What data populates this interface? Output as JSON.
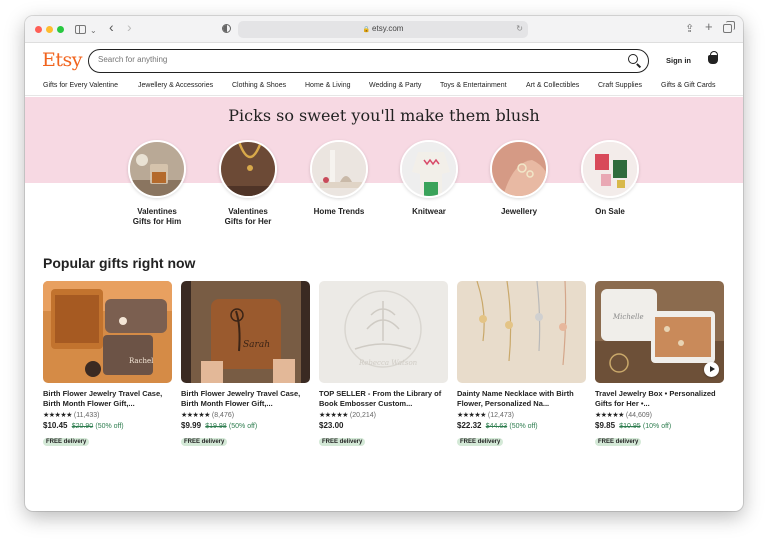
{
  "browser": {
    "url": "etsy.com",
    "icons": [
      "sidebar-icon",
      "chevron-down-icon",
      "back-icon",
      "forward-icon",
      "privacy-icon",
      "lock-icon",
      "reload-icon",
      "share-icon",
      "new-tab-icon",
      "tabs-overview-icon"
    ]
  },
  "header": {
    "logo": "Etsy",
    "search_placeholder": "Search for anything",
    "signin": "Sign in",
    "brand_color": "#f1641e"
  },
  "categories_nav": [
    "Gifts for Every Valentine",
    "Jewellery & Accessories",
    "Clothing & Shoes",
    "Home & Living",
    "Wedding & Party",
    "Toys & Entertainment",
    "Art & Collectibles",
    "Craft Supplies",
    "Gifts & Gift Cards"
  ],
  "banner": {
    "title": "Picks so sweet you'll make them blush",
    "background": "#f7d9e3",
    "categories": [
      {
        "label_line1": "Valentines",
        "label_line2": "Gifts for Him"
      },
      {
        "label_line1": "Valentines",
        "label_line2": "Gifts for Her"
      },
      {
        "label_line1": "Home Trends",
        "label_line2": ""
      },
      {
        "label_line1": "Knitwear",
        "label_line2": ""
      },
      {
        "label_line1": "Jewellery",
        "label_line2": ""
      },
      {
        "label_line1": "On Sale",
        "label_line2": ""
      }
    ]
  },
  "popular": {
    "heading": "Popular gifts right now",
    "products": [
      {
        "title": "Birth Flower Jewelry Travel Case, Birth Month Flower Gift,...",
        "stars": "★★★★★",
        "reviews": "(11,433)",
        "price": "$10.45",
        "original": "$20.90",
        "discount": "(50% off)",
        "badge": "FREE delivery"
      },
      {
        "title": "Birth Flower Jewelry Travel Case, Birth Month Flower Gift,...",
        "stars": "★★★★★",
        "reviews": "(8,476)",
        "price": "$9.99",
        "original": "$19.98",
        "discount": "(50% off)",
        "badge": "FREE delivery"
      },
      {
        "title": "TOP SELLER - From the Library of Book Embosser Custom...",
        "stars": "★★★★★",
        "reviews": "(20,214)",
        "price": "$23.00",
        "original": "",
        "discount": "",
        "badge": "FREE delivery"
      },
      {
        "title": "Dainty Name Necklace with Birth Flower, Personalized Na...",
        "stars": "★★★★★",
        "reviews": "(12,473)",
        "price": "$22.32",
        "original": "$44.63",
        "discount": "(50% off)",
        "badge": "FREE delivery"
      },
      {
        "title": "Travel Jewelry Box • Personalized Gifts for Her •...",
        "stars": "★★★★★",
        "reviews": "(44,609)",
        "price": "$9.85",
        "original": "$10.95",
        "discount": "(10% off)",
        "badge": "FREE delivery"
      }
    ]
  }
}
